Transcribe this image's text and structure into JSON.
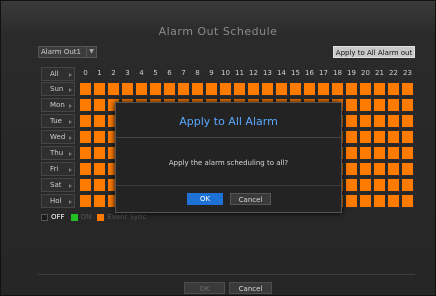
{
  "window": {
    "title": "Alarm Out Schedule"
  },
  "toolbar": {
    "alarm_select": "Alarm Out1",
    "apply_all_button": "Apply to All Alarm out"
  },
  "schedule": {
    "all_label": "All",
    "hours": [
      "0",
      "1",
      "2",
      "3",
      "4",
      "5",
      "6",
      "7",
      "8",
      "9",
      "10",
      "11",
      "12",
      "13",
      "14",
      "15",
      "16",
      "17",
      "18",
      "19",
      "20",
      "21",
      "22",
      "23"
    ],
    "days": [
      "Sun",
      "Mon",
      "Tue",
      "Wed",
      "Thu",
      "Fri",
      "Sat",
      "Hol"
    ]
  },
  "legend": {
    "off": "OFF",
    "on": "ON",
    "event_sync": "Event Sync"
  },
  "colors": {
    "off": "#1a1a1a",
    "on": "#22c022",
    "event_sync": "#ff7b00",
    "accent": "#1e72d6"
  },
  "footer": {
    "ok": "OK",
    "cancel": "Cancel"
  },
  "dialog": {
    "title": "Apply to All Alarm",
    "message": "Apply the alarm scheduling to all?",
    "ok": "OK",
    "cancel": "Cancel"
  }
}
